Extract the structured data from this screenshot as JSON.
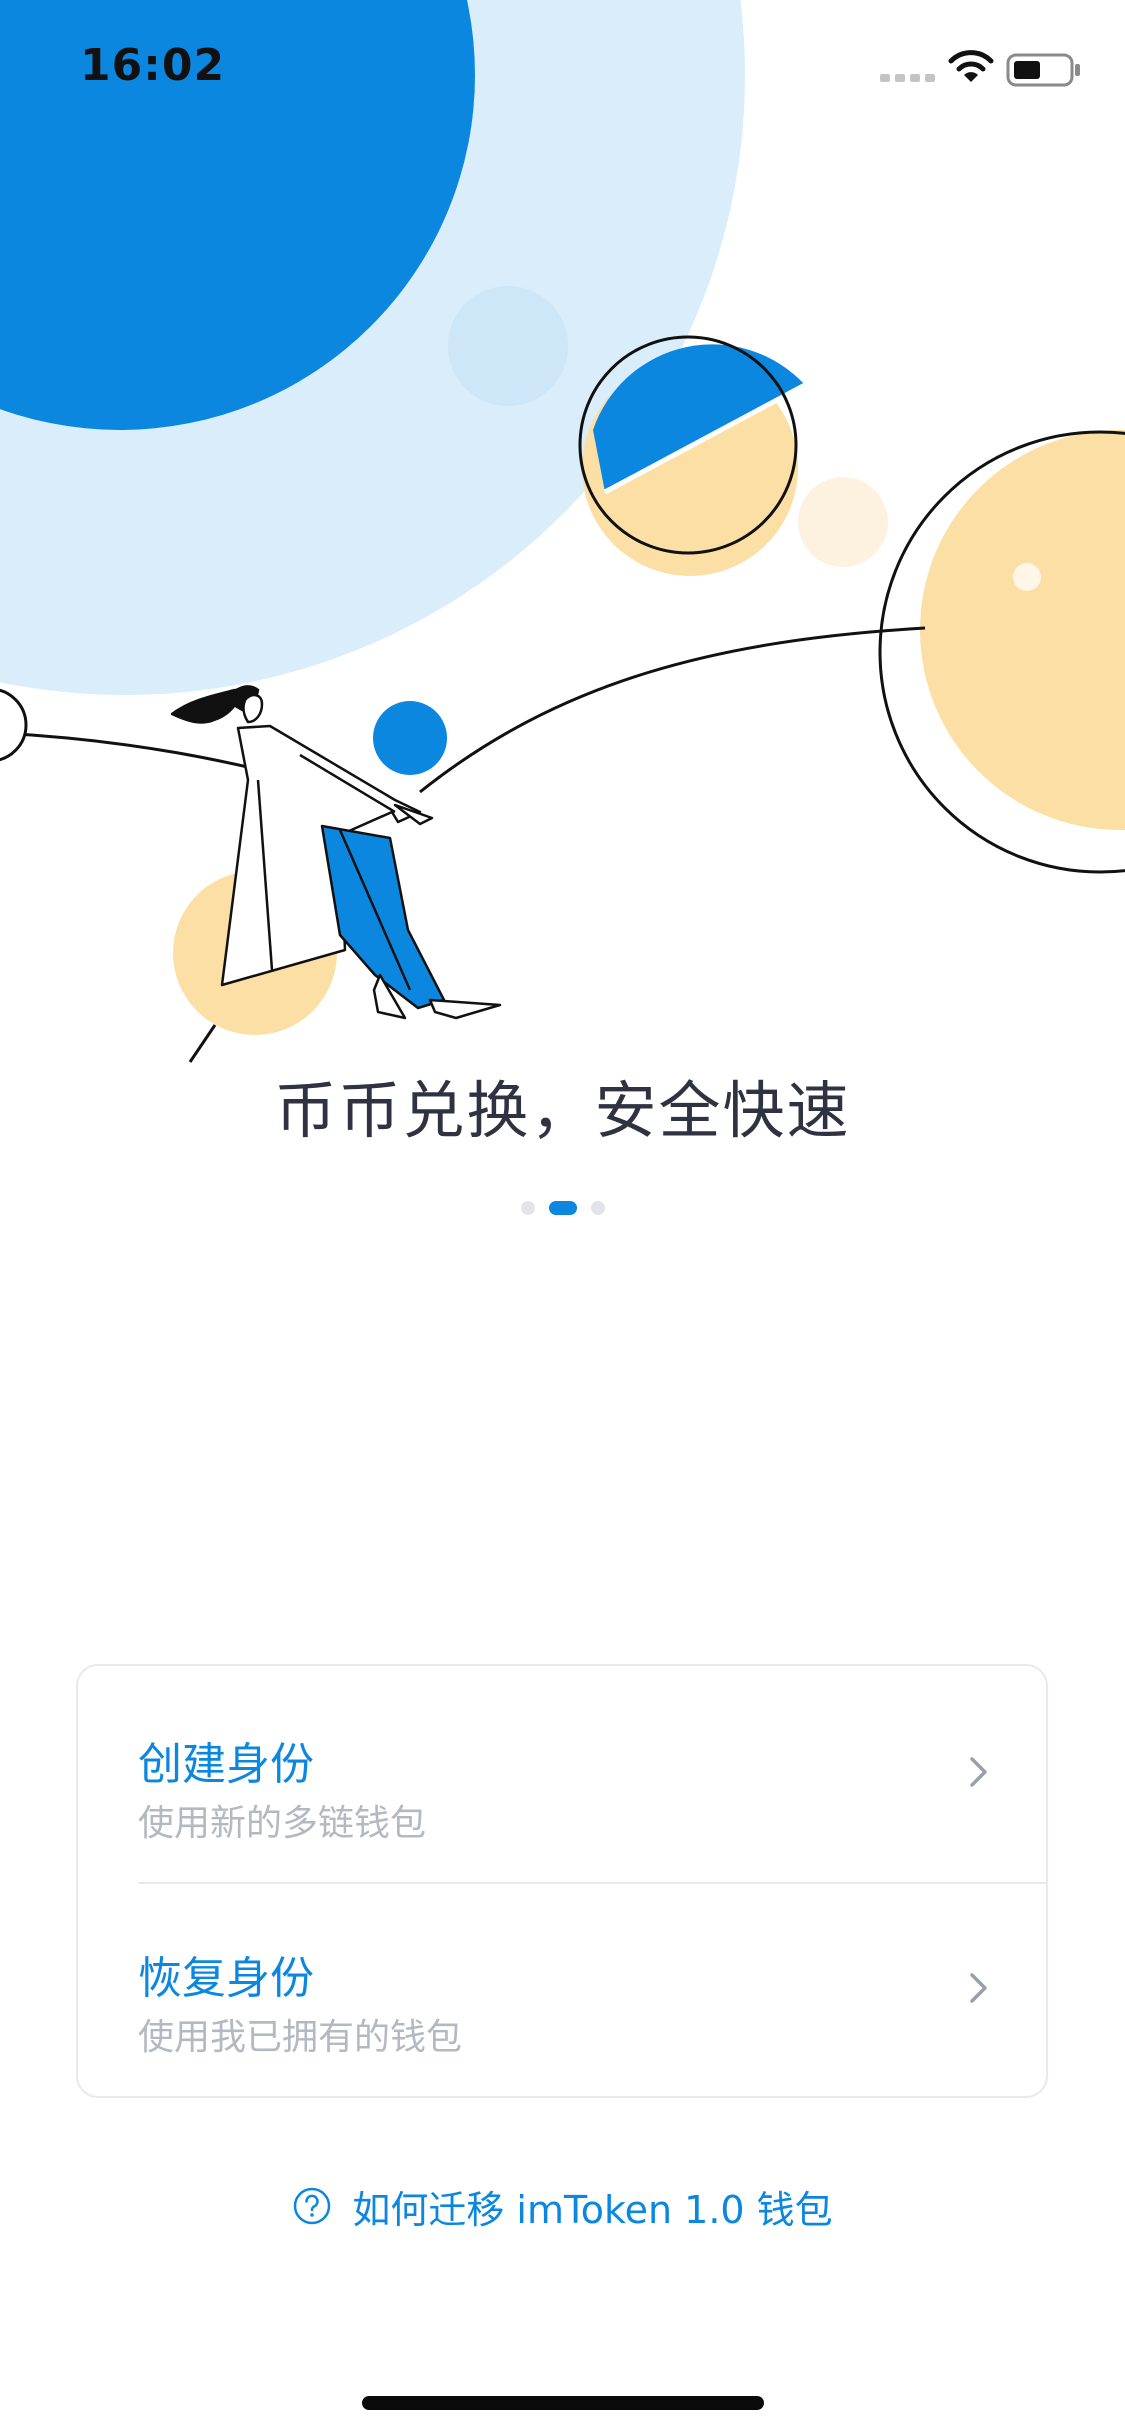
{
  "status_bar": {
    "time": "16:02",
    "icons": [
      "signal-icon",
      "wifi-icon",
      "battery-icon"
    ]
  },
  "onboarding": {
    "slide_title": "币币兑换，安全快速",
    "page_count": 3,
    "active_page": 2
  },
  "actions": {
    "create": {
      "title": "创建身份",
      "subtitle": "使用新的多链钱包",
      "icon": "chevron-right-icon"
    },
    "restore": {
      "title": "恢复身份",
      "subtitle": "使用我已拥有的钱包",
      "icon": "chevron-right-icon"
    }
  },
  "help": {
    "icon": "help-icon",
    "label": "如何迁移 imToken 1.0 钱包"
  },
  "colors": {
    "accent": "#0c87e0",
    "light_blue": "#d9edfb",
    "sand": "#fbdfa5",
    "title_text": "#2f3241",
    "subtitle_text": "#b4b8c2",
    "border": "#e6e9f0"
  }
}
